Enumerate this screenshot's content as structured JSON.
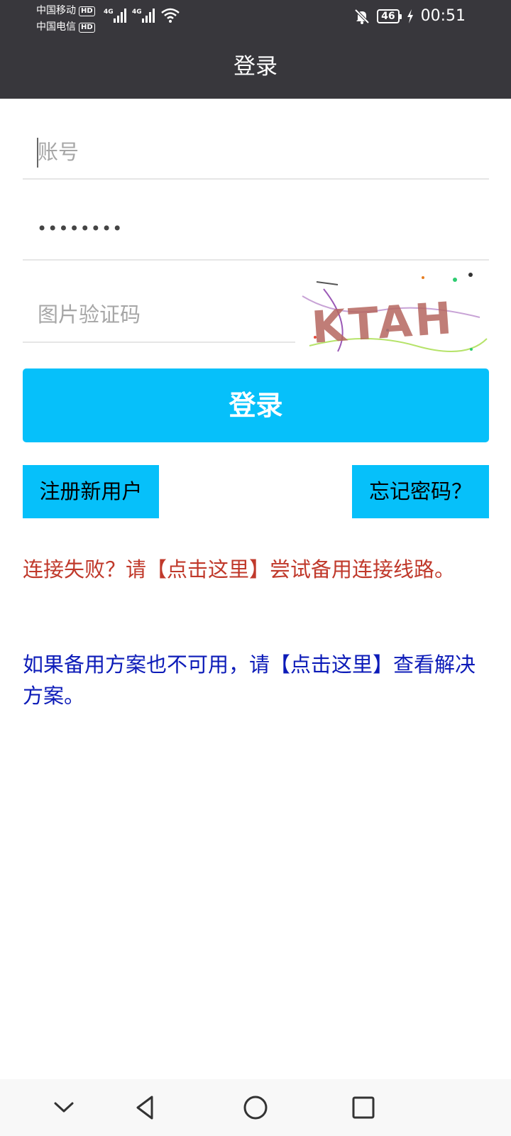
{
  "status_bar": {
    "carrier_1": "中国移动",
    "carrier_2": "中国电信",
    "hd_badge": "HD",
    "network_tag": "4G",
    "battery_level": "46",
    "time": "00:51"
  },
  "header": {
    "title": "登录"
  },
  "form": {
    "account_placeholder": "账号",
    "password_mask": "••••••••",
    "captcha_placeholder": "图片验证码",
    "captcha_image_text": "KTAH",
    "login_label": "登录"
  },
  "actions": {
    "register_label": "注册新用户",
    "forgot_label": "忘记密码？"
  },
  "messages": {
    "backup_line": "连接失败？请【点击这里】尝试备用连接线路。",
    "solution": "如果备用方案也不可用，请【点击这里】查看解决方案。"
  },
  "colors": {
    "header_bg": "#38373c",
    "accent": "#06c0fa",
    "error_text": "#c0392b",
    "info_text": "#0c1bb8"
  },
  "nav_icons": [
    "chevron-down-icon",
    "back-icon",
    "home-icon",
    "recents-icon"
  ]
}
